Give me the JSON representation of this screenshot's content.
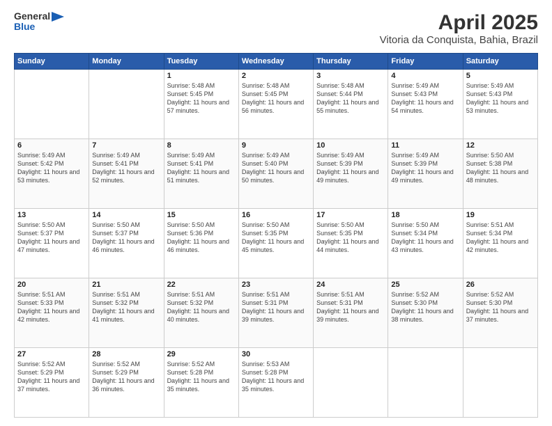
{
  "header": {
    "logo_line1": "General",
    "logo_line2": "Blue",
    "month": "April 2025",
    "location": "Vitoria da Conquista, Bahia, Brazil"
  },
  "weekdays": [
    "Sunday",
    "Monday",
    "Tuesday",
    "Wednesday",
    "Thursday",
    "Friday",
    "Saturday"
  ],
  "weeks": [
    [
      {
        "day": "",
        "text": ""
      },
      {
        "day": "",
        "text": ""
      },
      {
        "day": "1",
        "text": "Sunrise: 5:48 AM\nSunset: 5:45 PM\nDaylight: 11 hours and 57 minutes."
      },
      {
        "day": "2",
        "text": "Sunrise: 5:48 AM\nSunset: 5:45 PM\nDaylight: 11 hours and 56 minutes."
      },
      {
        "day": "3",
        "text": "Sunrise: 5:48 AM\nSunset: 5:44 PM\nDaylight: 11 hours and 55 minutes."
      },
      {
        "day": "4",
        "text": "Sunrise: 5:49 AM\nSunset: 5:43 PM\nDaylight: 11 hours and 54 minutes."
      },
      {
        "day": "5",
        "text": "Sunrise: 5:49 AM\nSunset: 5:43 PM\nDaylight: 11 hours and 53 minutes."
      }
    ],
    [
      {
        "day": "6",
        "text": "Sunrise: 5:49 AM\nSunset: 5:42 PM\nDaylight: 11 hours and 53 minutes."
      },
      {
        "day": "7",
        "text": "Sunrise: 5:49 AM\nSunset: 5:41 PM\nDaylight: 11 hours and 52 minutes."
      },
      {
        "day": "8",
        "text": "Sunrise: 5:49 AM\nSunset: 5:41 PM\nDaylight: 11 hours and 51 minutes."
      },
      {
        "day": "9",
        "text": "Sunrise: 5:49 AM\nSunset: 5:40 PM\nDaylight: 11 hours and 50 minutes."
      },
      {
        "day": "10",
        "text": "Sunrise: 5:49 AM\nSunset: 5:39 PM\nDaylight: 11 hours and 49 minutes."
      },
      {
        "day": "11",
        "text": "Sunrise: 5:49 AM\nSunset: 5:39 PM\nDaylight: 11 hours and 49 minutes."
      },
      {
        "day": "12",
        "text": "Sunrise: 5:50 AM\nSunset: 5:38 PM\nDaylight: 11 hours and 48 minutes."
      }
    ],
    [
      {
        "day": "13",
        "text": "Sunrise: 5:50 AM\nSunset: 5:37 PM\nDaylight: 11 hours and 47 minutes."
      },
      {
        "day": "14",
        "text": "Sunrise: 5:50 AM\nSunset: 5:37 PM\nDaylight: 11 hours and 46 minutes."
      },
      {
        "day": "15",
        "text": "Sunrise: 5:50 AM\nSunset: 5:36 PM\nDaylight: 11 hours and 46 minutes."
      },
      {
        "day": "16",
        "text": "Sunrise: 5:50 AM\nSunset: 5:35 PM\nDaylight: 11 hours and 45 minutes."
      },
      {
        "day": "17",
        "text": "Sunrise: 5:50 AM\nSunset: 5:35 PM\nDaylight: 11 hours and 44 minutes."
      },
      {
        "day": "18",
        "text": "Sunrise: 5:50 AM\nSunset: 5:34 PM\nDaylight: 11 hours and 43 minutes."
      },
      {
        "day": "19",
        "text": "Sunrise: 5:51 AM\nSunset: 5:34 PM\nDaylight: 11 hours and 42 minutes."
      }
    ],
    [
      {
        "day": "20",
        "text": "Sunrise: 5:51 AM\nSunset: 5:33 PM\nDaylight: 11 hours and 42 minutes."
      },
      {
        "day": "21",
        "text": "Sunrise: 5:51 AM\nSunset: 5:32 PM\nDaylight: 11 hours and 41 minutes."
      },
      {
        "day": "22",
        "text": "Sunrise: 5:51 AM\nSunset: 5:32 PM\nDaylight: 11 hours and 40 minutes."
      },
      {
        "day": "23",
        "text": "Sunrise: 5:51 AM\nSunset: 5:31 PM\nDaylight: 11 hours and 39 minutes."
      },
      {
        "day": "24",
        "text": "Sunrise: 5:51 AM\nSunset: 5:31 PM\nDaylight: 11 hours and 39 minutes."
      },
      {
        "day": "25",
        "text": "Sunrise: 5:52 AM\nSunset: 5:30 PM\nDaylight: 11 hours and 38 minutes."
      },
      {
        "day": "26",
        "text": "Sunrise: 5:52 AM\nSunset: 5:30 PM\nDaylight: 11 hours and 37 minutes."
      }
    ],
    [
      {
        "day": "27",
        "text": "Sunrise: 5:52 AM\nSunset: 5:29 PM\nDaylight: 11 hours and 37 minutes."
      },
      {
        "day": "28",
        "text": "Sunrise: 5:52 AM\nSunset: 5:29 PM\nDaylight: 11 hours and 36 minutes."
      },
      {
        "day": "29",
        "text": "Sunrise: 5:52 AM\nSunset: 5:28 PM\nDaylight: 11 hours and 35 minutes."
      },
      {
        "day": "30",
        "text": "Sunrise: 5:53 AM\nSunset: 5:28 PM\nDaylight: 11 hours and 35 minutes."
      },
      {
        "day": "",
        "text": ""
      },
      {
        "day": "",
        "text": ""
      },
      {
        "day": "",
        "text": ""
      }
    ]
  ]
}
